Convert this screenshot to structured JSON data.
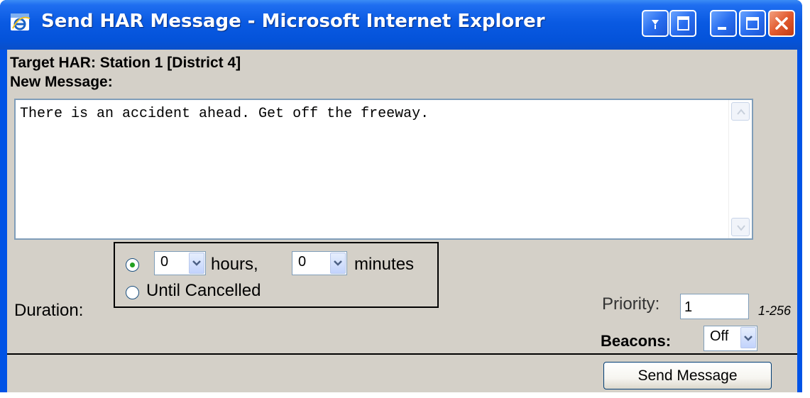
{
  "window": {
    "title": "Send HAR Message - Microsoft Internet Explorer",
    "icon": "ie-icon",
    "buttons": [
      "menu-icon",
      "restore-view-icon",
      "minimize-icon",
      "maximize-icon",
      "close-icon"
    ]
  },
  "target": {
    "text": "Target HAR: Station 1 [District 4]"
  },
  "message": {
    "label": "New Message:",
    "value": "There is an accident ahead. Get off the freeway."
  },
  "duration": {
    "label": "Duration:",
    "option_timed_selected": true,
    "hours_value": "0",
    "hours_label": "hours,",
    "minutes_value": "0",
    "minutes_label": "minutes",
    "until_cancelled_label": "Until Cancelled"
  },
  "priority": {
    "label": "Priority:",
    "value": "1",
    "range": "1-256"
  },
  "beacons": {
    "label": "Beacons:",
    "value": "Off"
  },
  "send_button_label": "Send Message",
  "colors": {
    "title_bar": "#0a5ae2",
    "client_bg": "#d4d0c8",
    "radio_dot": "#21a121",
    "close_button": "#e25b2f"
  }
}
